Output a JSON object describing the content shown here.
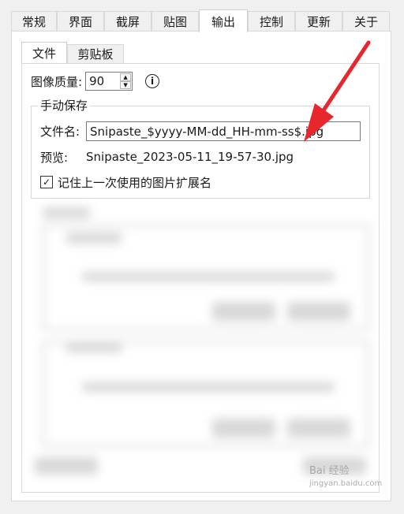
{
  "top_tabs": [
    {
      "label": "常规",
      "active": false
    },
    {
      "label": "界面",
      "active": false
    },
    {
      "label": "截屏",
      "active": false
    },
    {
      "label": "贴图",
      "active": false
    },
    {
      "label": "输出",
      "active": true
    },
    {
      "label": "控制",
      "active": false
    },
    {
      "label": "更新",
      "active": false
    },
    {
      "label": "关于",
      "active": false
    }
  ],
  "sub_tabs": [
    {
      "label": "文件",
      "active": true
    },
    {
      "label": "剪贴板",
      "active": false
    }
  ],
  "quality": {
    "label": "图像质量:",
    "value": "90"
  },
  "manual_save": {
    "title": "手动保存",
    "filename_label": "文件名:",
    "filename_value": "Snipaste_$yyyy-MM-dd_HH-mm-ss$.jpg",
    "preview_label": "预览:",
    "preview_value": "Snipaste_2023-05-11_19-57-30.jpg",
    "remember_label": "记住上一次使用的图片扩展名",
    "remember_checked": true
  },
  "watermark": {
    "line1": "Bai 经验",
    "line2": "jingyan.baidu.com"
  },
  "colors": {
    "arrow": "#e8262e",
    "panel": "#ffffff",
    "background": "#f0f0f0"
  },
  "icons": {
    "info": "info-icon",
    "spin_up": "chevron-up-icon",
    "spin_down": "chevron-down-icon",
    "check": "checkmark-icon"
  }
}
